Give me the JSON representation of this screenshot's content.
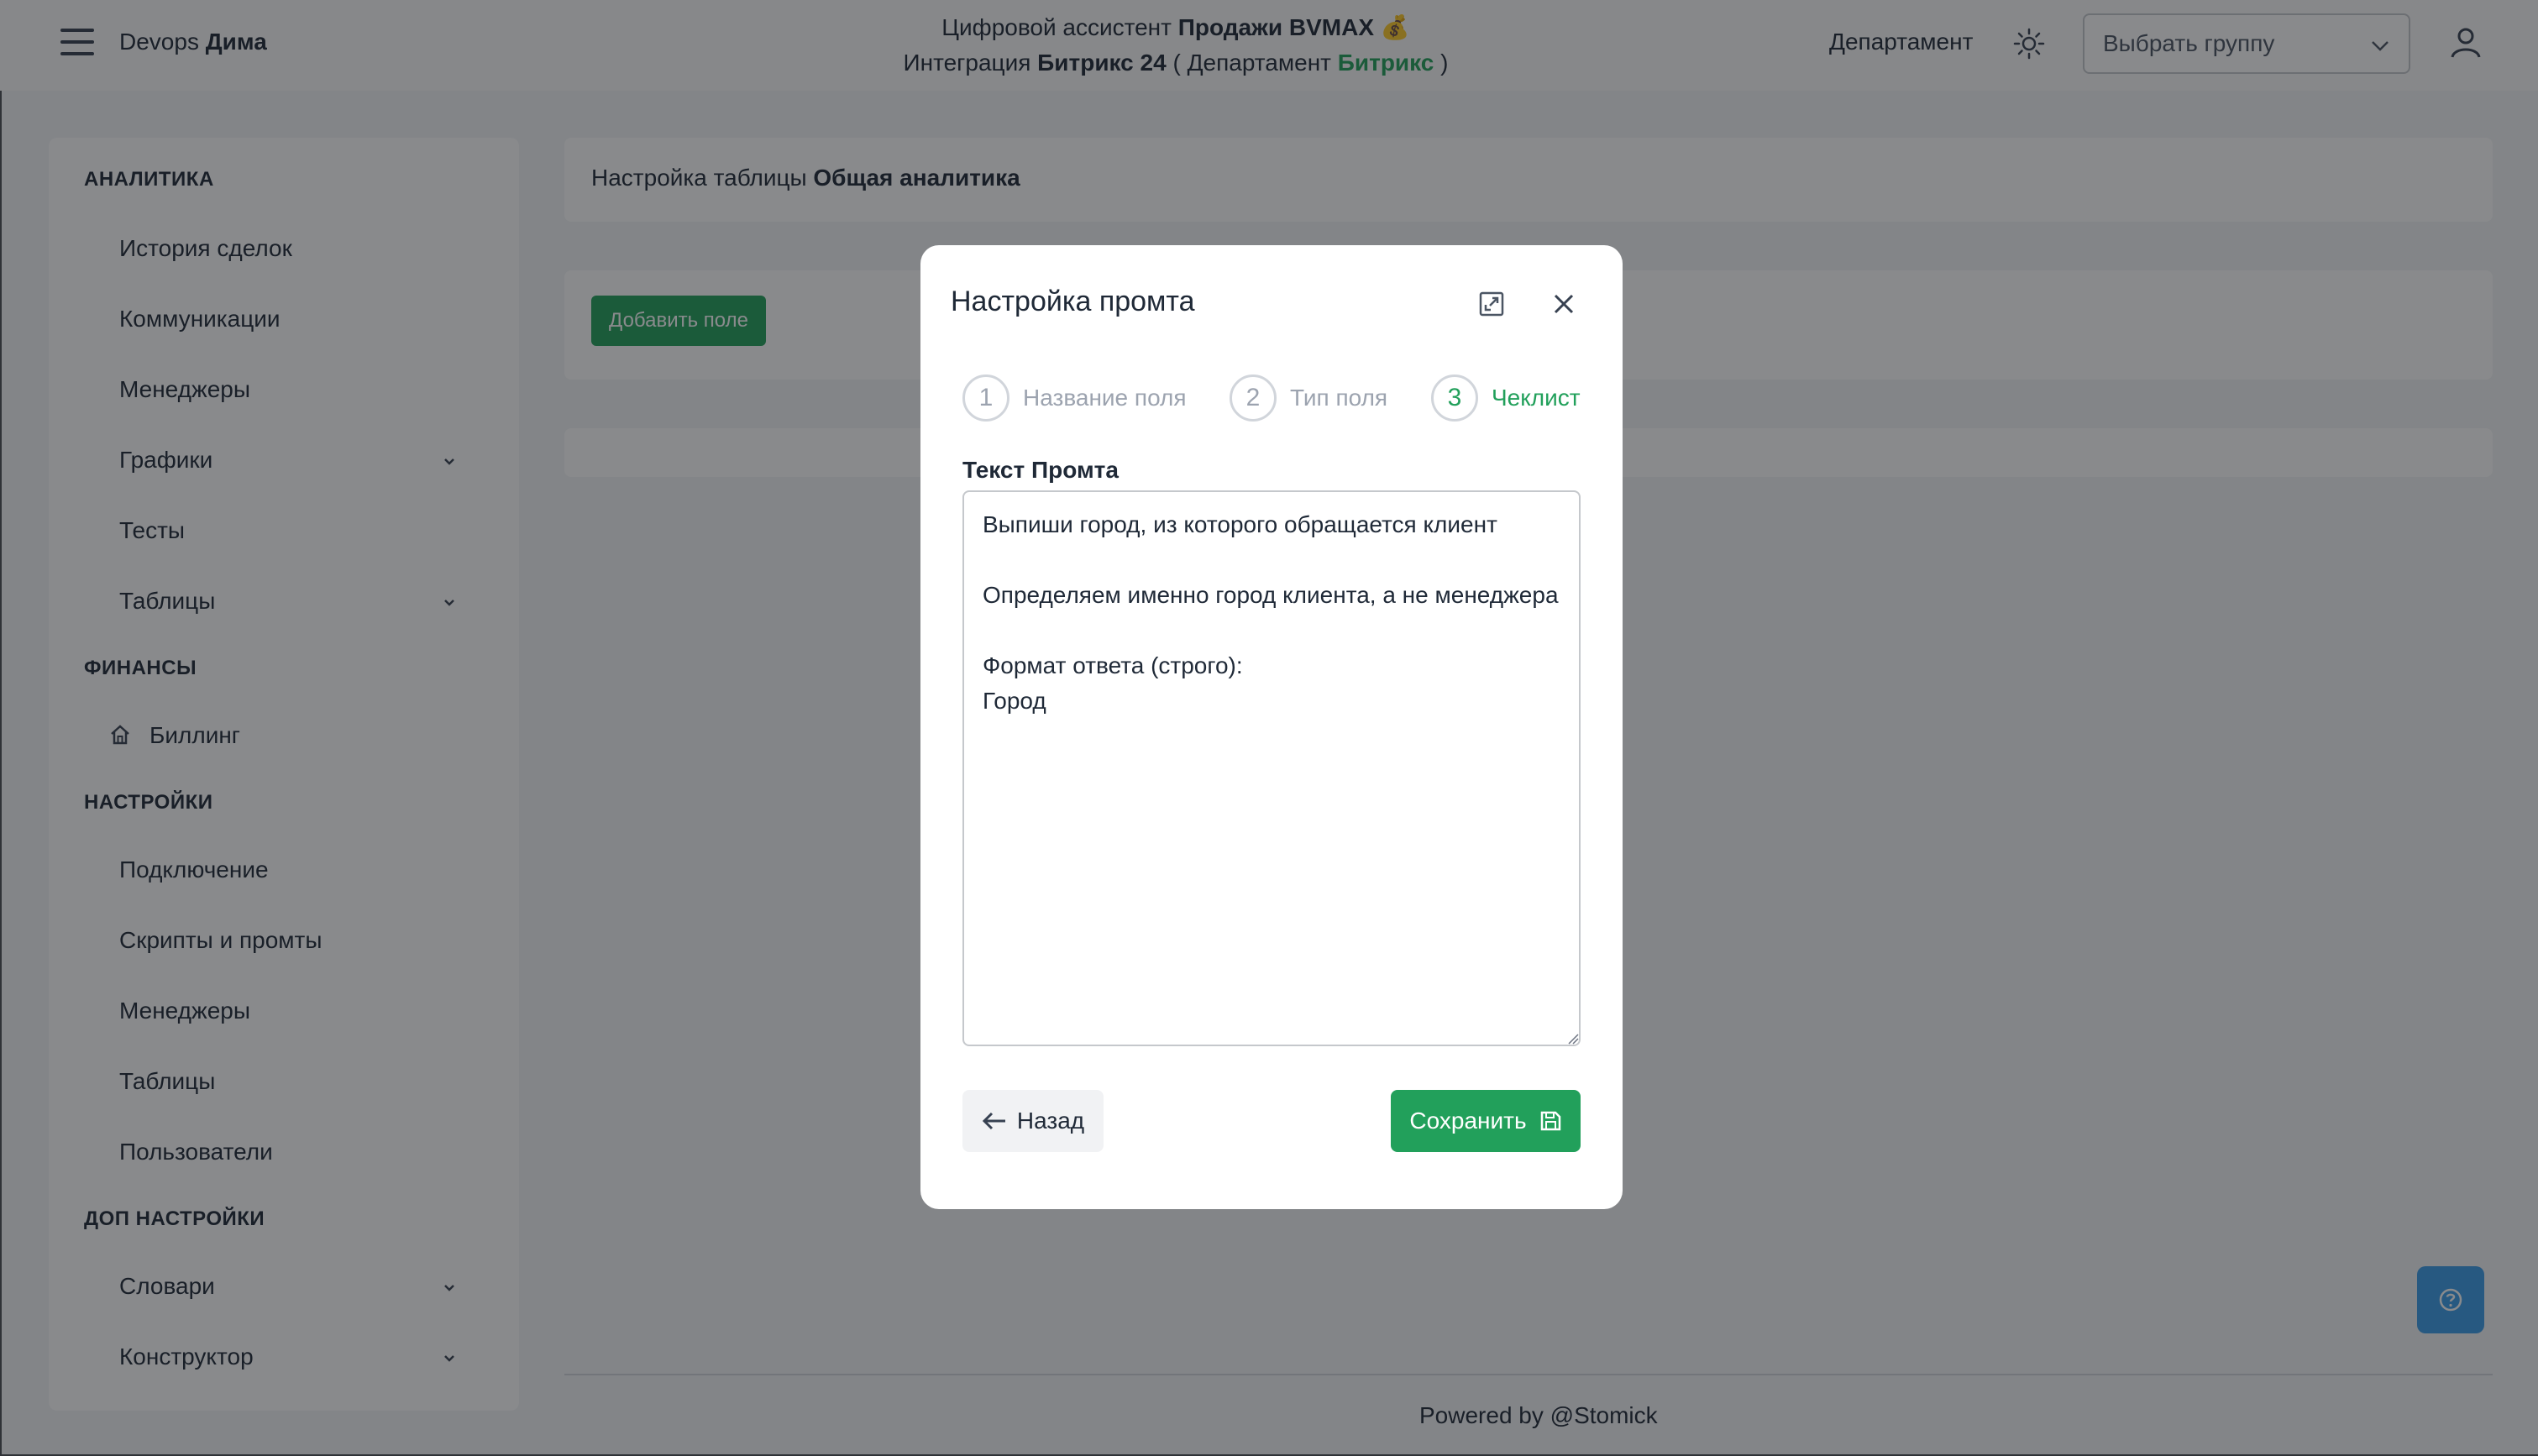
{
  "header": {
    "brand_prefix": "Devops",
    "brand_name": "Дима",
    "title_line1_prefix": "Цифровой ассистент",
    "title_line1_bold": "Продажи BVMAX",
    "title_line1_emoji": "💰",
    "title_line2_prefix": "Интеграция",
    "title_line2_bold": "Битрикс 24",
    "title_line2_dept_open": "( Департамент",
    "title_line2_dept_name": "Битрикс",
    "title_line2_dept_close": ")",
    "department_label": "Департамент",
    "group_select_value": "Выбрать группу"
  },
  "sidebar": {
    "sections": [
      {
        "title": "АНАЛИТИКА"
      },
      {
        "title": "ФИНАНСЫ"
      },
      {
        "title": "НАСТРОЙКИ"
      },
      {
        "title": "ДОП НАСТРОЙКИ"
      }
    ],
    "items": [
      {
        "label": "История сделок"
      },
      {
        "label": "Коммуникации"
      },
      {
        "label": "Менеджеры"
      },
      {
        "label": "Графики"
      },
      {
        "label": "Тесты"
      },
      {
        "label": "Таблицы"
      },
      {
        "label": "Биллинг"
      },
      {
        "label": "Подключение"
      },
      {
        "label": "Скрипты и промты"
      },
      {
        "label": "Менеджеры"
      },
      {
        "label": "Таблицы"
      },
      {
        "label": "Пользователи"
      },
      {
        "label": "Словари"
      },
      {
        "label": "Конструктор"
      }
    ]
  },
  "main": {
    "title_prefix": "Настройка таблицы",
    "title_bold": "Общая аналитика",
    "add_field_label": "Добавить поле",
    "footer": "Powered by @Stomick"
  },
  "modal": {
    "title": "Настройка промта",
    "steps": [
      {
        "number": "1",
        "label": "Название поля"
      },
      {
        "number": "2",
        "label": "Тип поля"
      },
      {
        "number": "3",
        "label": "Чеклист"
      }
    ],
    "active_step": 3,
    "field_label": "Текст Промта",
    "prompt_text": "Выпиши город, из которого обращается клиент\n\nОпределяем именно город клиента, а не менеджера\n\nФормат ответа (строго):\nГород",
    "back_label": "Назад",
    "save_label": "Сохранить"
  },
  "colors": {
    "accent_green": "#22a05b",
    "help_blue": "#3b9de8"
  },
  "icons": [
    "menu-icon",
    "sun-icon",
    "chevron-down-icon",
    "user-icon",
    "home-icon",
    "expand-icon",
    "close-icon",
    "arrow-left-icon",
    "save-icon",
    "help-icon"
  ]
}
